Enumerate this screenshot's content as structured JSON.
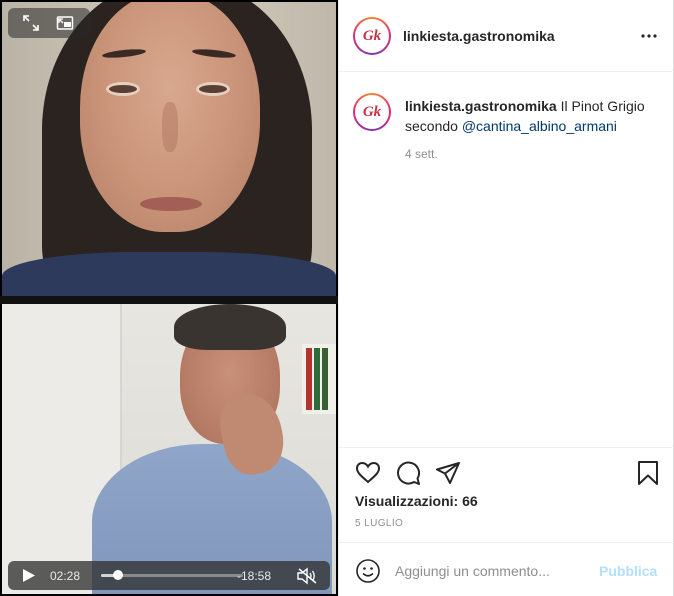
{
  "video": {
    "current_time": "02:28",
    "remaining_time": "-18:58",
    "progress_fraction": 0.12,
    "expand_icon": "expand-icon",
    "pip_icon": "picture-in-picture-icon",
    "play_icon": "play-icon",
    "mute_icon": "speaker-muted-icon"
  },
  "post": {
    "avatar_text": "Gk",
    "username": "linkiesta.gastronomika",
    "caption_text": " Il Pinot Grigio secondo ",
    "caption_mention": "@cantina_albino_armani",
    "time_ago": "4 sett.",
    "views_label": "Visualizzazioni: 66",
    "date": "5 LUGLIO"
  },
  "comment": {
    "placeholder": "Aggiungi un commento...",
    "publish_label": "Pubblica"
  },
  "colors": {
    "brand_red": "#c63246",
    "publish_disabled": "#b2dffc",
    "mention_blue": "#00376b"
  }
}
